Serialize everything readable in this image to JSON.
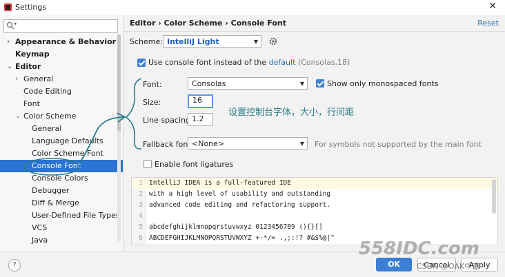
{
  "window": {
    "title": "Settings"
  },
  "sidebar": {
    "search": {
      "placeholder": ""
    },
    "items": [
      {
        "label": "Appearance & Behavior",
        "arrow": "›",
        "bold": true
      },
      {
        "label": "Keymap",
        "arrow": "",
        "bold": true
      },
      {
        "label": "Editor",
        "arrow": "⌄",
        "bold": true
      },
      {
        "label": "General",
        "arrow": "›",
        "bold": false
      },
      {
        "label": "Code Editing",
        "arrow": "",
        "bold": false
      },
      {
        "label": "Font",
        "arrow": "",
        "bold": false
      },
      {
        "label": "Color Scheme",
        "arrow": "⌄",
        "bold": false
      },
      {
        "label": "General",
        "arrow": "",
        "bold": false
      },
      {
        "label": "Language Defaults",
        "arrow": "",
        "bold": false
      },
      {
        "label": "Color Scheme Font",
        "arrow": "",
        "bold": false
      },
      {
        "label": "Console Font",
        "arrow": "",
        "bold": false,
        "selected": true
      },
      {
        "label": "Console Colors",
        "arrow": "",
        "bold": false
      },
      {
        "label": "Debugger",
        "arrow": "",
        "bold": false
      },
      {
        "label": "Diff & Merge",
        "arrow": "",
        "bold": false
      },
      {
        "label": "User-Defined File Types",
        "arrow": "",
        "bold": false
      },
      {
        "label": "VCS",
        "arrow": "",
        "bold": false
      },
      {
        "label": "Java",
        "arrow": "",
        "bold": false
      }
    ]
  },
  "header": {
    "breadcrumb": "Editor  ›  Color Scheme  ›  Console Font",
    "reset": "Reset"
  },
  "scheme": {
    "label": "Scheme:",
    "value": "IntelliJ Light"
  },
  "use_console_font": {
    "checked": true,
    "text": "Use console font instead of the",
    "link": "default",
    "suffix": "(Consolas,18)"
  },
  "font": {
    "label": "Font:",
    "value": "Consolas"
  },
  "monospaced": {
    "checked": true,
    "label": "Show only monospaced fonts"
  },
  "size": {
    "label": "Size:",
    "value": "16"
  },
  "line_spacing": {
    "label": "Line spacing:",
    "value": "1.2"
  },
  "annotation": "设置控制台字体，大小，行间距",
  "fallback": {
    "label": "Fallback font:",
    "value": "<None>",
    "hint": "For symbols not supported by the main font"
  },
  "ligatures": {
    "checked": false,
    "label": "Enable font ligatures"
  },
  "preview": {
    "lines": [
      {
        "num": "1",
        "code": "IntelliJ IDEA is a full-featured IDE"
      },
      {
        "num": "2",
        "code": "with a high level of usability and outstanding"
      },
      {
        "num": "3",
        "code": "advanced code editing and refactoring support."
      },
      {
        "num": "4",
        "code": ""
      },
      {
        "num": "5",
        "code": "abcdefghijklmnopqrstuvwxyz 0123456789 (){}[]"
      },
      {
        "num": "6",
        "code": "ABCDEFGHIJKLMNOPQRSTUVWXYZ +-*/= .,;:!? #&$%@|^"
      }
    ]
  },
  "footer": {
    "help": "?",
    "ok": "OK",
    "cancel": "Cancel",
    "apply": "Apply"
  },
  "watermark": {
    "logo": "558IDC.com",
    "text": "CSDN @OAK中道"
  },
  "colors": {
    "accent": "#3b7fd4",
    "selection": "#2b73d4",
    "link": "#2470b3",
    "annotation": "#2a7a8a"
  }
}
